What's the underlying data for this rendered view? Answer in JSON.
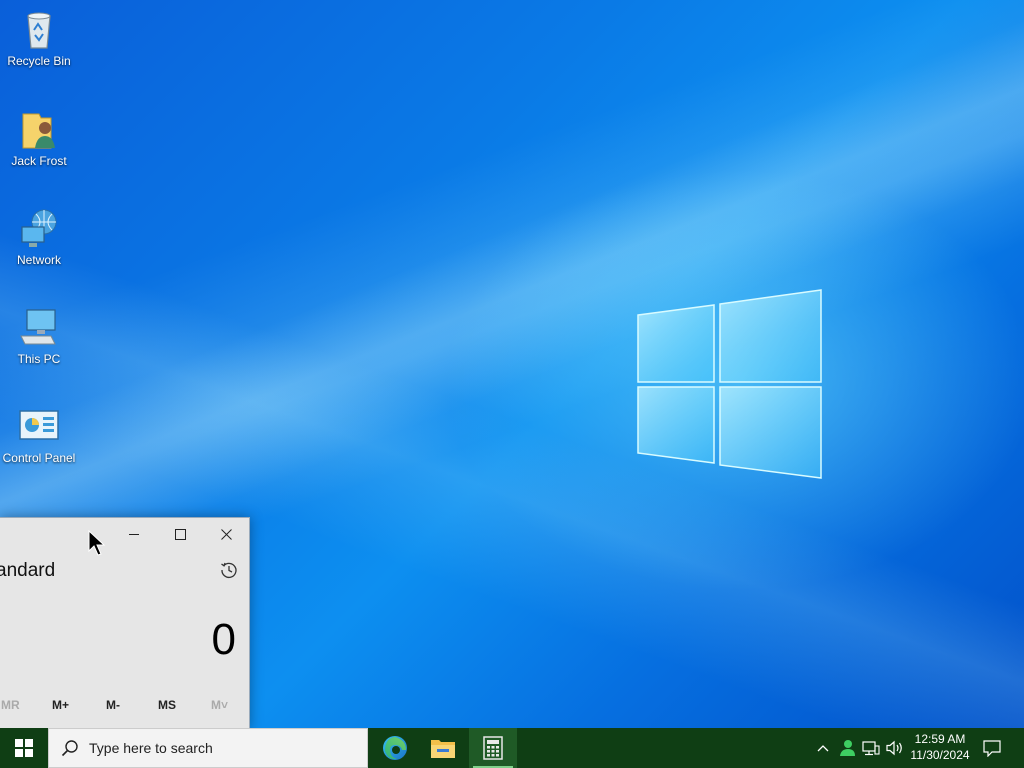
{
  "desktop": {
    "icons": [
      {
        "label": "Recycle Bin",
        "icon": "recycle-bin-icon"
      },
      {
        "label": "Jack Frost",
        "icon": "user-folder-icon"
      },
      {
        "label": "Network",
        "icon": "network-icon"
      },
      {
        "label": "This PC",
        "icon": "this-pc-icon"
      },
      {
        "label": "Control Panel",
        "icon": "control-panel-icon"
      }
    ]
  },
  "calculator": {
    "mode_title": "andard",
    "display_value": "0",
    "memory_buttons": [
      "MR",
      "M+",
      "M-",
      "MS",
      "M˅"
    ],
    "window_controls": [
      "minimize",
      "maximize",
      "close"
    ]
  },
  "taskbar": {
    "search_placeholder": "Type here to search",
    "pinned_apps": [
      "edge-icon",
      "file-explorer-icon",
      "calculator-icon"
    ],
    "active_app": "calculator-icon",
    "clock": {
      "time": "12:59 AM",
      "date": "11/30/2024"
    },
    "tray_icons": [
      "chevron-up-icon",
      "people-icon",
      "network-status-icon",
      "volume-icon",
      "notification-icon"
    ]
  },
  "colors": {
    "taskbar_bg": "#0f3e14",
    "desktop_accent": "#0a7ae6"
  }
}
